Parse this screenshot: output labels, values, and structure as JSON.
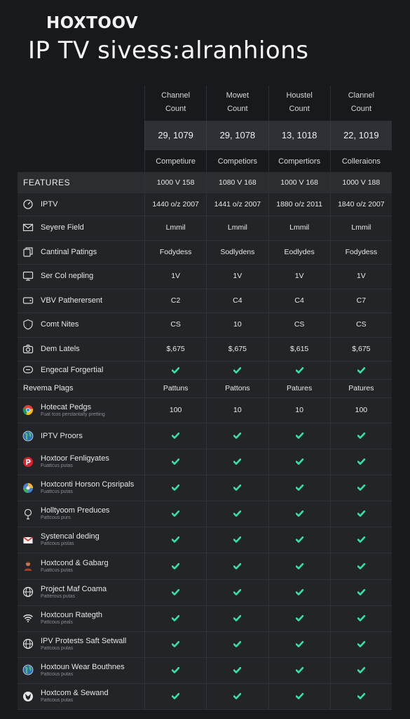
{
  "brand": "HOXTOOV",
  "title": "IP TV  sivess:alranhions",
  "columns": [
    {
      "header1": "Channel",
      "header2": "Count",
      "count": "29, 1079",
      "sub": "Competiure"
    },
    {
      "header1": "Mowet",
      "header2": "Count",
      "count": "29, 1078",
      "sub": "Competiors"
    },
    {
      "header1": "Houstel",
      "header2": "Count",
      "count": "13, 1018",
      "sub": "Compertiors"
    },
    {
      "header1": "Clannel",
      "header2": "Count",
      "count": "22, 1019",
      "sub": "Colleraions"
    }
  ],
  "table": {
    "features_label": "FEATURES",
    "features_values": [
      "1000 V 158",
      "1080 V 168",
      "1000 V 168",
      "1000 V 188"
    ],
    "rows": [
      {
        "icon": "gauge-icon",
        "label": "IPTV",
        "values": [
          "1440 o/z 2007",
          "1441 o/z 2007",
          "1880 o/z 2011",
          "1840 o/z 2007"
        ]
      },
      {
        "icon": "mail-icon",
        "label": "Seyere Field",
        "values": [
          "Lmmil",
          "Lmmil",
          "Lmmil",
          "Lmmil"
        ]
      },
      {
        "icon": "copy-icon",
        "label": "Cantinal Patings",
        "values": [
          "Fodydess",
          "Sodlydens",
          "Eodlydes",
          "Fodydess"
        ]
      },
      {
        "icon": "monitor-icon",
        "label": "Ser Col nepling",
        "values": [
          "1V",
          "1V",
          "1V",
          "1V"
        ]
      },
      {
        "icon": "tv-icon",
        "label": "VBV Patherersent",
        "values": [
          "C2",
          "C4",
          "C4",
          "C7"
        ]
      },
      {
        "icon": "shield-icon",
        "label": "Comt Nites",
        "values": [
          "CS",
          "10",
          "CS",
          "CS"
        ]
      },
      {
        "icon": "camera-icon",
        "label": "Dem Latels",
        "values": [
          "$,675",
          "$,675",
          "$,615",
          "$,675"
        ]
      },
      {
        "icon": "chat-icon",
        "label": "Engecal Forgertial",
        "values": [
          "check",
          "check",
          "check",
          "check"
        ]
      }
    ],
    "section_label": "Revema Plags",
    "section_values": [
      "Pattuns",
      "Pattons",
      "Patures",
      "Patures"
    ],
    "services": [
      {
        "icon": "chrome-icon",
        "label": "Hotecat Pedgs",
        "sublabel": "Fuat tcos perstantally pretting",
        "values": [
          "100",
          "10",
          "10",
          "100"
        ]
      },
      {
        "icon": "earth-icon",
        "label": "IPTV Proors",
        "sublabel": "",
        "values": [
          "check",
          "check",
          "check",
          "check"
        ]
      },
      {
        "icon": "pinterest-icon",
        "label": "Hoxtoor Fenligyates",
        "sublabel": "Fuattcus putas",
        "values": [
          "check",
          "check",
          "check",
          "check"
        ]
      },
      {
        "icon": "globe-color-icon",
        "label": "Hoxtconti Horson Cpsripals",
        "sublabel": "Fuattcus putas",
        "values": [
          "check",
          "check",
          "check",
          "check"
        ]
      },
      {
        "icon": "lamp-icon",
        "label": "Holltyoom Preduces",
        "sublabel": "Pattcous purs",
        "values": [
          "check",
          "check",
          "check",
          "check"
        ]
      },
      {
        "icon": "gmail-icon",
        "label": "Systencal deding",
        "sublabel": "Pattcous pistas",
        "values": [
          "check",
          "check",
          "check",
          "check"
        ]
      },
      {
        "icon": "person-icon",
        "label": "Hoxtcond & Gabarg",
        "sublabel": "Fuattcus putas",
        "values": [
          "check",
          "check",
          "check",
          "check"
        ]
      },
      {
        "icon": "globe-icon",
        "label": "Project Maf Coama",
        "sublabel": "Patterous putas",
        "values": [
          "check",
          "check",
          "check",
          "check"
        ]
      },
      {
        "icon": "wifi-icon",
        "label": "Hoxtcoun Rategth",
        "sublabel": "Pattcous peals",
        "values": [
          "check",
          "check",
          "check",
          "check"
        ]
      },
      {
        "icon": "globe-icon",
        "label": "IPV Protests Saft Setwall",
        "sublabel": "Pattcous putas",
        "values": [
          "check",
          "check",
          "check",
          "check"
        ]
      },
      {
        "icon": "earth-icon",
        "label": "Hoxtoun Wear Bouthnes",
        "sublabel": "Pattcous putas",
        "values": [
          "check",
          "check",
          "check",
          "check"
        ]
      },
      {
        "icon": "fox-icon",
        "label": "Hoxtcom & Sewand",
        "sublabel": "Pattcous putas",
        "values": [
          "check",
          "check",
          "check",
          "check"
        ]
      }
    ]
  },
  "colors": {
    "check": "#35e0a6",
    "background": "#18191c",
    "panel": "#232428"
  }
}
